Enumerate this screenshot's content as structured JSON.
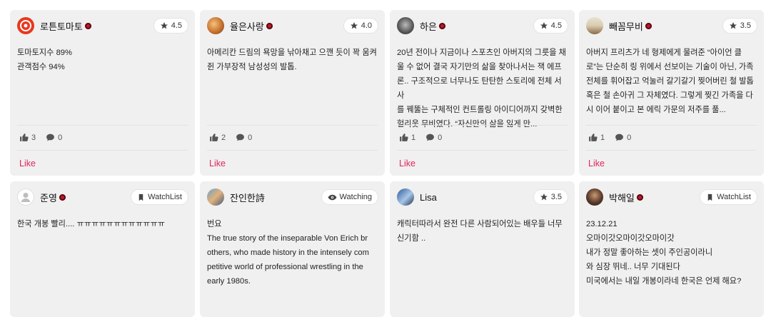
{
  "reviews": [
    {
      "user": "로튼토마토",
      "badge": "4.5",
      "text": "토마토지수 89%\n관객점수 94%",
      "likes": "3",
      "comments": "0",
      "like_label": "Like"
    },
    {
      "user": "율은사랑",
      "badge": "4.0",
      "text": "아메리칸 드림의 욕망을 낚아채고 으깬 듯이 꽉 움켜\n쥔 가부장적 남성성의 발톱.",
      "likes": "2",
      "comments": "0",
      "like_label": "Like"
    },
    {
      "user": "하은",
      "badge": "4.5",
      "text": "20년 전이나 지금이나 스포츠인 아버지의 그릇을 채\n울 수 없어 결국 자기만의 삶을 찾아나서는 잭 에프\n론.. 구조적으로 너무나도 탄탄한 스토리에 전체 서사\n를 꿰뚫는 구체적인 컨트롤링 아이디어까지 갖벽한\n헐리웃 무비였다. “자신만의 삶을 잃게 만...",
      "likes": "1",
      "comments": "0",
      "like_label": "Like"
    },
    {
      "user": "빼꼼무비",
      "badge": "3.5",
      "text": "아버지 프리츠가 네 형제에게 물려준 “아이언 클\n로”는 단순히 링 위에서 선보이는 기술이 아닌, 가족\n전체를 휘어잡고 억눌러 갈기갈기 찢어버린 철 발톱\n혹은 철 손아귀 그 자체였다. 그렇게 찢긴 가족을 다\n시 이어 붙이고 본 에릭 가문의 저주를 풀...",
      "likes": "1",
      "comments": "0",
      "like_label": "Like"
    },
    {
      "user": "준영",
      "badge": "WatchList",
      "text": "한국 개봉 빨리.... ㅠㅠㅠㅠㅠㅠㅠㅠㅠㅠㅠㅠ"
    },
    {
      "user": "잔인한詩",
      "badge": "Watching",
      "text": "번요\nThe true story of the inseparable Von Erich br\nothers, who made history in the intensely com\npetitive world of professional wrestling in the\nearly 1980s."
    },
    {
      "user": "Lisa",
      "badge": "3.5",
      "text": "캐릭터따라서 완전 다른 사람되어있는 배우들 너무\n신기함 .."
    },
    {
      "user": "박해일",
      "badge": "WatchList",
      "text": "23.12.21\n오마이갓오마이갓오마이갓\n내가 정말 좋아하는 셋이 주인공이라니\n와 심장 뛰네.. 너무 기대된다\n미국에서는 내일 개봉이라네 한국은 언제 해요?"
    }
  ]
}
